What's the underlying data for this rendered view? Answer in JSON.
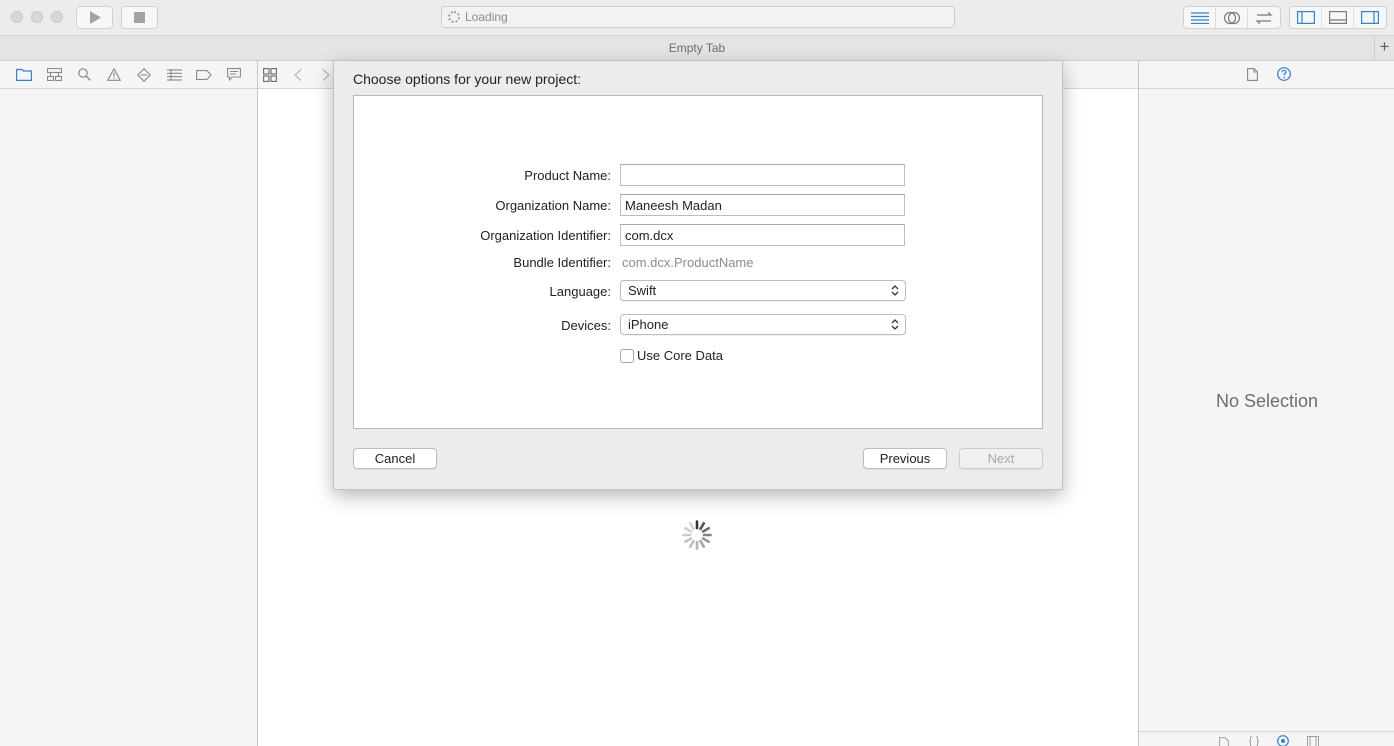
{
  "toolbar": {
    "activity_status": "Loading"
  },
  "tab": {
    "title": "Empty Tab",
    "add_label": "+"
  },
  "inspector": {
    "empty_message": "No Selection"
  },
  "dialog": {
    "title": "Choose options for your new project:",
    "fields": {
      "product_name": {
        "label": "Product Name:",
        "value": ""
      },
      "organization_name": {
        "label": "Organization Name:",
        "value": "Maneesh Madan"
      },
      "organization_identifier": {
        "label": "Organization Identifier:",
        "value": "com.dcx"
      },
      "bundle_identifier": {
        "label": "Bundle Identifier:",
        "value": "com.dcx.ProductName"
      },
      "language": {
        "label": "Language:",
        "value": "Swift"
      },
      "devices": {
        "label": "Devices:",
        "value": "iPhone"
      },
      "use_core_data": {
        "label": "Use Core Data",
        "checked": false
      }
    },
    "buttons": {
      "cancel": "Cancel",
      "previous": "Previous",
      "next": "Next"
    }
  },
  "colors": {
    "accent": "#2c82e0",
    "chrome": "#ececec"
  }
}
